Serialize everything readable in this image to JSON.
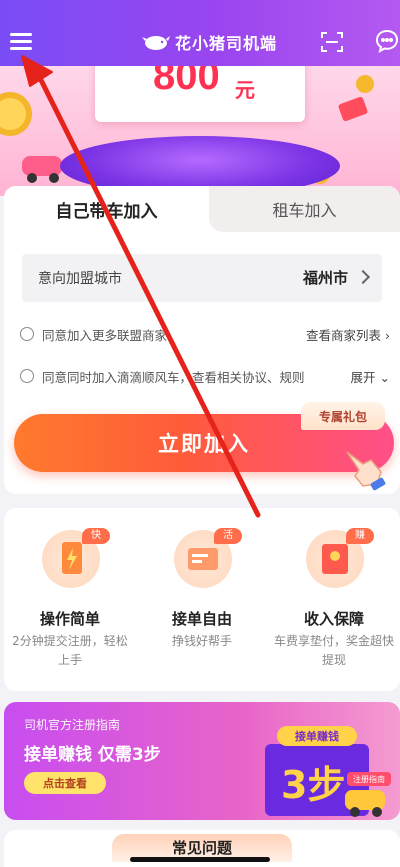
{
  "header": {
    "title": "花小猪司机端",
    "menu_icon": "hamburger-menu-icon",
    "scan_icon": "scan-icon",
    "chat_icon": "chat-bubble-icon"
  },
  "banner": {
    "amount": "800",
    "unit": "元"
  },
  "tabs": [
    {
      "label": "自己带车加入",
      "active": true
    },
    {
      "label": "租车加入",
      "active": false
    }
  ],
  "form": {
    "city_label": "意向加盟城市",
    "city_value": "福州市",
    "agree_more": "同意加入更多联盟商家",
    "agree_more_link": "查看商家列表",
    "agree_hitch": "同意同时加入滴滴顺风车，查看相关协议、规则",
    "agree_hitch_link": "展开",
    "gift_badge": "专属礼包",
    "join_button": "立即加入"
  },
  "features": [
    {
      "badge": "快",
      "title": "操作简单",
      "desc": "2分钟提交注册，轻松上手"
    },
    {
      "badge": "活",
      "title": "接单自由",
      "desc": "挣钱好帮手"
    },
    {
      "badge": "赚",
      "title": "收入保障",
      "desc": "车费享垫付，奖金超快提现"
    }
  ],
  "guide": {
    "subtitle": "司机官方注册指南",
    "title": "接单赚钱 仅需3步",
    "button": "点击查看",
    "art_banner": "接单赚钱",
    "art_steps": "3步",
    "art_tag": "注册指南"
  },
  "faq": {
    "title": "常见问题"
  },
  "colors": {
    "header": "#8b47f2",
    "primary_button": "#ff5b3b",
    "amount": "#ff3152",
    "annotation_arrow": "#e5231b"
  }
}
